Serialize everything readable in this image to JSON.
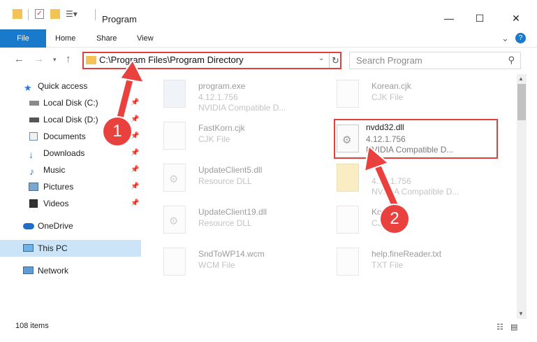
{
  "window": {
    "title": "Program",
    "minimize": "—",
    "maximize": "☐",
    "close": "✕"
  },
  "ribbon": {
    "tabs": [
      "File",
      "Home",
      "Share",
      "View"
    ],
    "help": "?",
    "collapse": "⌄"
  },
  "address": {
    "path": "C:\\Program Files\\Program Directory",
    "search_placeholder": "Search Program"
  },
  "sidebar": {
    "items": [
      {
        "label": "Quick access",
        "icon": "star-icon"
      },
      {
        "label": "Local Disk (C:)",
        "icon": "drive-icon",
        "pinned": true
      },
      {
        "label": "Local Disk (D:)",
        "icon": "drive-icon",
        "pinned": true
      },
      {
        "label": "Documents",
        "icon": "documents-icon",
        "pinned": true
      },
      {
        "label": "Downloads",
        "icon": "downloads-icon",
        "pinned": true
      },
      {
        "label": "Music",
        "icon": "music-icon",
        "pinned": true
      },
      {
        "label": "Pictures",
        "icon": "pictures-icon",
        "pinned": true
      },
      {
        "label": "Videos",
        "icon": "videos-icon",
        "pinned": true
      },
      {
        "label": "OneDrive",
        "icon": "cloud-icon"
      },
      {
        "label": "This PC",
        "icon": "monitor-icon",
        "selected": true
      },
      {
        "label": "Network",
        "icon": "network-icon"
      }
    ]
  },
  "files": [
    {
      "name": "program.exe",
      "line1": "4.12.1.756",
      "line2": "NVIDIA Compatible D..."
    },
    {
      "name": "Korean.cjk",
      "line1": "CJK File"
    },
    {
      "name": "FastKorn.cjk",
      "line1": "CJK File"
    },
    {
      "name": "nvdd32.dll",
      "line1": "4.12.1.756",
      "line2": "NVIDIA Compatible D..."
    },
    {
      "name": "UpdateClient5.dll",
      "line1": "Resource DLL"
    },
    {
      "name": "",
      "line1": "4.12.1.756",
      "line2": "NVIDIA Compatible D..."
    },
    {
      "name": "UpdateClient19.dll",
      "line1": "Resource DLL"
    },
    {
      "name": "Korean",
      "line1": "CJK File"
    },
    {
      "name": "SndToWP14.wcm",
      "line1": "WCM File"
    },
    {
      "name": "help.fineReader.txt",
      "line1": "TXT File"
    }
  ],
  "status": {
    "item_count": "108 items"
  },
  "callouts": {
    "one": "1",
    "two": "2"
  },
  "colors": {
    "accent": "#1979ca",
    "highlight": "#e0413f",
    "selected": "#cce4f7"
  }
}
